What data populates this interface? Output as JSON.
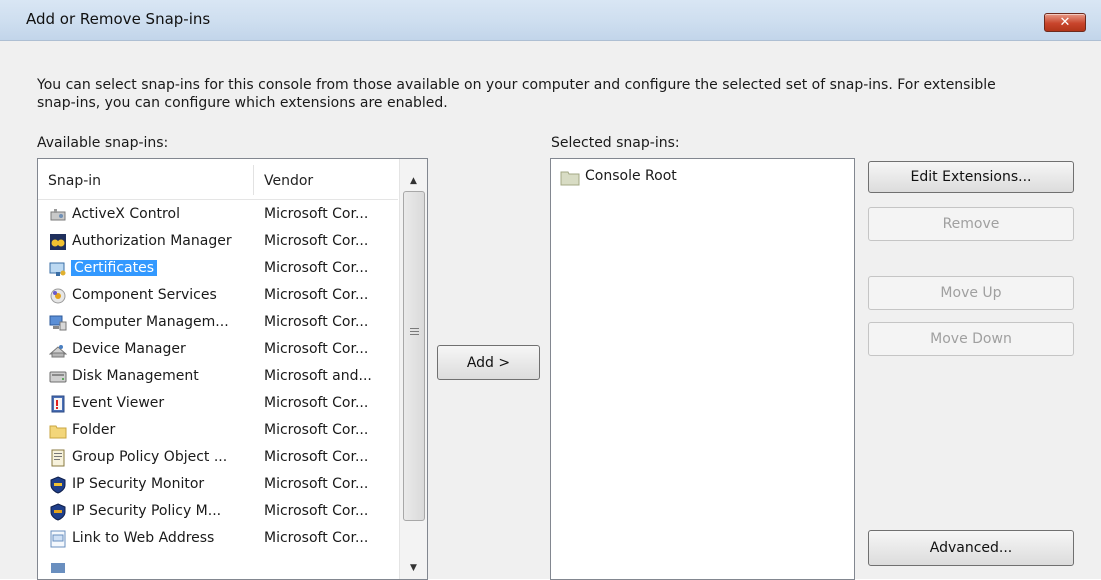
{
  "window": {
    "title": "Add or Remove Snap-ins",
    "close_symbol": "✕"
  },
  "intro_text": "You can select snap-ins for this console from those available on your computer and configure the selected set of snap-ins. For extensible snap-ins, you can configure which extensions are enabled.",
  "available": {
    "label": "Available snap-ins:",
    "columns": {
      "snapin": "Snap-in",
      "vendor": "Vendor"
    },
    "items": [
      {
        "name": "ActiveX Control",
        "vendor": "Microsoft Cor...",
        "icon": "activex-control-icon"
      },
      {
        "name": "Authorization Manager",
        "vendor": "Microsoft Cor...",
        "icon": "authorization-manager-icon"
      },
      {
        "name": "Certificates",
        "vendor": "Microsoft Cor...",
        "icon": "certificates-icon",
        "selected": true
      },
      {
        "name": "Component Services",
        "vendor": "Microsoft Cor...",
        "icon": "component-services-icon"
      },
      {
        "name": "Computer Managem...",
        "vendor": "Microsoft Cor...",
        "icon": "computer-management-icon"
      },
      {
        "name": "Device Manager",
        "vendor": "Microsoft Cor...",
        "icon": "device-manager-icon"
      },
      {
        "name": "Disk Management",
        "vendor": "Microsoft and...",
        "icon": "disk-management-icon"
      },
      {
        "name": "Event Viewer",
        "vendor": "Microsoft Cor...",
        "icon": "event-viewer-icon"
      },
      {
        "name": "Folder",
        "vendor": "Microsoft Cor...",
        "icon": "folder-icon"
      },
      {
        "name": "Group Policy Object ...",
        "vendor": "Microsoft Cor...",
        "icon": "group-policy-icon"
      },
      {
        "name": "IP Security Monitor",
        "vendor": "Microsoft Cor...",
        "icon": "ip-security-monitor-icon"
      },
      {
        "name": "IP Security Policy M...",
        "vendor": "Microsoft Cor...",
        "icon": "ip-security-policy-icon"
      },
      {
        "name": "Link to Web Address",
        "vendor": "Microsoft Cor...",
        "icon": "link-web-address-icon"
      }
    ]
  },
  "add_button": "Add >",
  "selected_snapins": {
    "label": "Selected snap-ins:",
    "items": [
      {
        "name": "Console Root",
        "icon": "folder-icon"
      }
    ]
  },
  "buttons": {
    "edit_extensions": "Edit Extensions...",
    "remove": "Remove",
    "move_up": "Move Up",
    "move_down": "Move Down",
    "advanced": "Advanced..."
  },
  "colors": {
    "selection": "#3399ff",
    "title_gradient": "#cfdff0",
    "close_button": "#c8452c"
  }
}
